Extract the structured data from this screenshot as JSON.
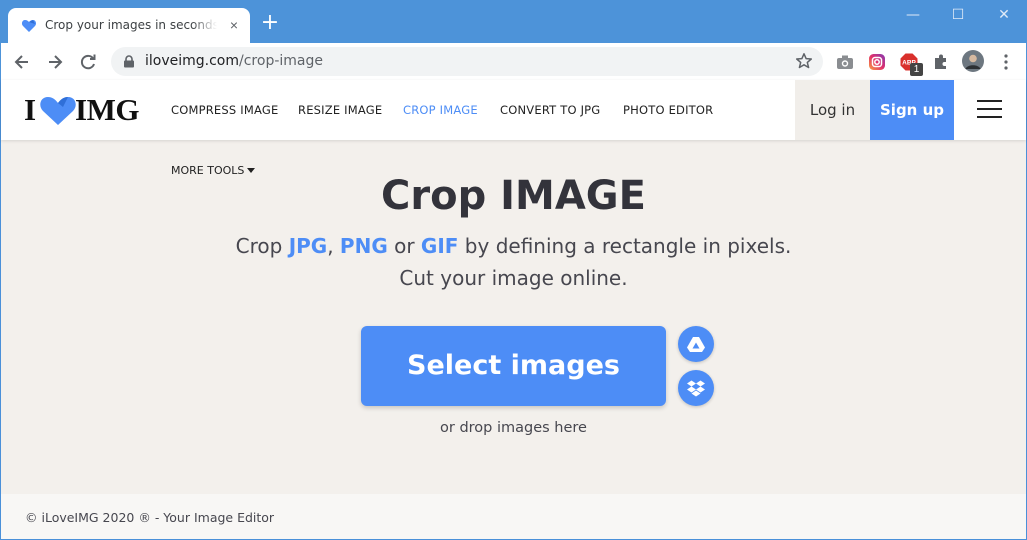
{
  "browser": {
    "tab_title": "Crop your images in seconds for free",
    "tab_close": "×",
    "new_tab": "+",
    "window_controls": {
      "minimize": "—",
      "maximize": "☐",
      "close": "✕"
    },
    "url_domain": "iloveimg.com",
    "url_path": "/crop-image",
    "adblock_badge": "1",
    "extension_icons": [
      "camera-icon",
      "instagram-icon",
      "adblock-icon",
      "puzzle-icon",
      "profile-avatar",
      "kebab-menu-icon"
    ]
  },
  "site": {
    "logo_left": "I",
    "logo_right": "IMG",
    "nav": [
      {
        "label": "COMPRESS IMAGE",
        "active": false
      },
      {
        "label": "RESIZE IMAGE",
        "active": false
      },
      {
        "label": "CROP IMAGE",
        "active": true
      },
      {
        "label": "CONVERT TO JPG",
        "active": false
      },
      {
        "label": "PHOTO EDITOR",
        "active": false
      }
    ],
    "login_label": "Log in",
    "signup_label": "Sign up",
    "more_tools_label": "MORE TOOLS"
  },
  "hero": {
    "title": "Crop IMAGE",
    "sub_prefix": "Crop ",
    "fmt1": "JPG",
    "sep1": ", ",
    "fmt2": "PNG",
    "sep2": " or ",
    "fmt3": "GIF",
    "sub_suffix": " by defining a rectangle in pixels.",
    "sub_line2": "Cut your image online.",
    "select_label": "Select images",
    "drop_hint": "or drop images here"
  },
  "footer": {
    "text": "© iLoveIMG 2020 ® - Your Image Editor"
  },
  "colors": {
    "accent": "#4d8df6",
    "chrome_blue": "#4d93d9",
    "page_bg": "#f3f0ec"
  }
}
